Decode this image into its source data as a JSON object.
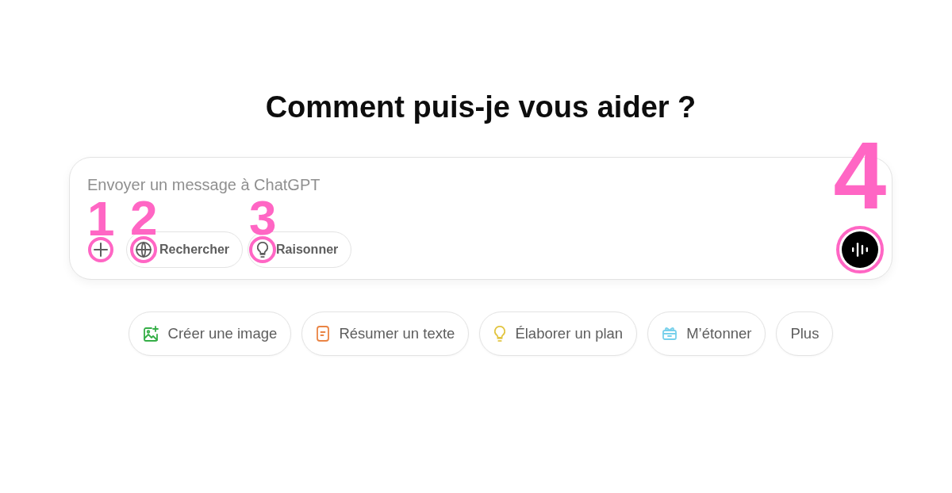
{
  "heading": "Comment puis-je vous aider ?",
  "composer": {
    "placeholder": "Envoyer un message à ChatGPT",
    "tools": [
      {
        "kind": "icon",
        "callout": "1"
      },
      {
        "kind": "pill",
        "label": "Rechercher",
        "callout": "2"
      },
      {
        "kind": "pill",
        "label": "Raisonner",
        "callout": "3"
      }
    ],
    "voice_button": {
      "callout": "4"
    }
  },
  "suggestions": [
    {
      "kind": "prompt",
      "label": "Créer une image",
      "color": "#35ae47"
    },
    {
      "kind": "prompt",
      "label": "Résumer un texte",
      "color": "#ea8444"
    },
    {
      "kind": "prompt",
      "label": "Élaborer un plan",
      "color": "#e2c541"
    },
    {
      "kind": "prompt",
      "label": "M’étonner",
      "color": "#76d0eb"
    },
    {
      "kind": "more",
      "label": "Plus"
    }
  ]
}
